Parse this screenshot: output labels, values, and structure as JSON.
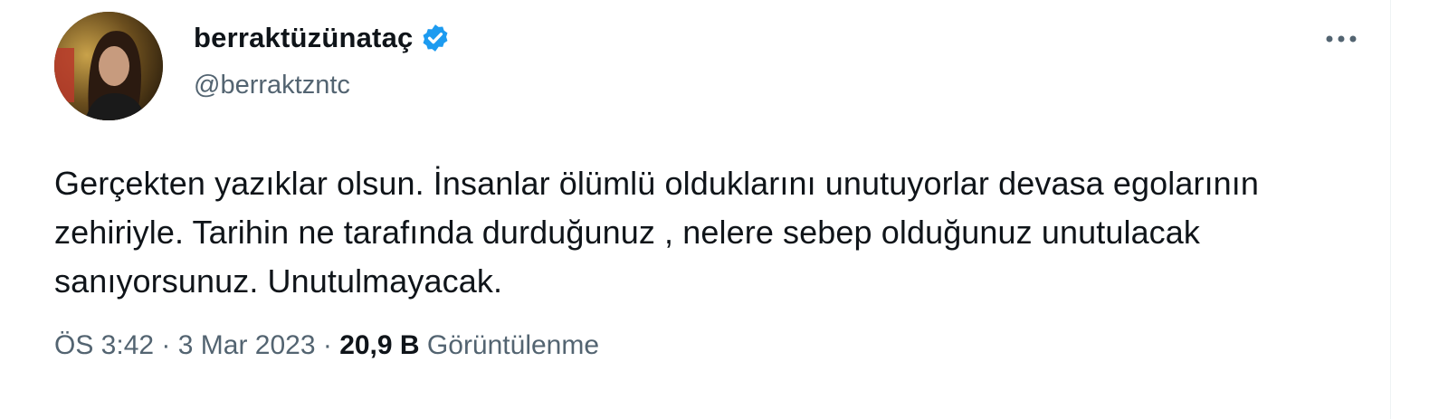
{
  "tweet": {
    "display_name": "berraktüzünataç",
    "handle": "@berraktzntc",
    "text": "Gerçekten yazıklar olsun. İnsanlar ölümlü olduklarını unutuyorlar devasa egolarının zehiriyle. Tarihin ne tarafında durduğunuz , nelere sebep olduğunuz unutulacak sanıyorsunuz. Unutulmayacak.",
    "time": "ÖS 3:42",
    "separator": " · ",
    "date": "3 Mar 2023",
    "views_count": "20,9 B",
    "views_label": "Görüntülenme",
    "verified_icon": "verified-badge-icon",
    "more_icon": "more-options-icon",
    "accent_color": "#1d9bf0"
  }
}
